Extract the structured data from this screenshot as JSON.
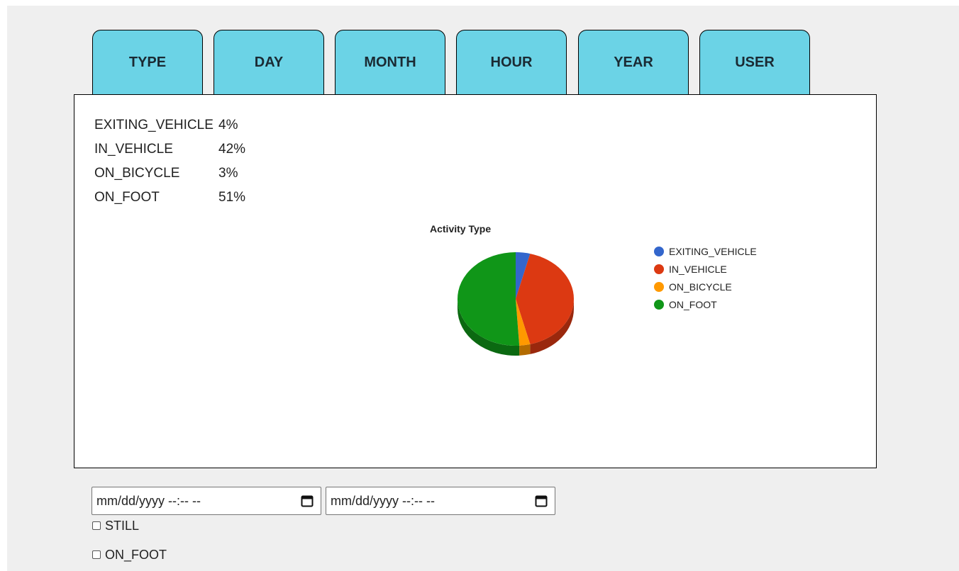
{
  "tabs": [
    {
      "label": "TYPE"
    },
    {
      "label": "DAY"
    },
    {
      "label": "MONTH"
    },
    {
      "label": "HOUR"
    },
    {
      "label": "YEAR"
    },
    {
      "label": "USER"
    }
  ],
  "stats": [
    {
      "name": "EXITING_VEHICLE",
      "value": "4%"
    },
    {
      "name": "IN_VEHICLE",
      "value": "42%"
    },
    {
      "name": "ON_BICYCLE",
      "value": "3%"
    },
    {
      "name": "ON_FOOT",
      "value": "51%"
    }
  ],
  "chart_data": {
    "type": "pie",
    "title": "Activity Type",
    "legend_position": "right",
    "slices": [
      {
        "label": "EXITING_VEHICLE",
        "value": 4,
        "color": "#3366cc",
        "dark": "#24488f"
      },
      {
        "label": "IN_VEHICLE",
        "value": 42,
        "color": "#dc3912",
        "dark": "#9a280d"
      },
      {
        "label": "ON_BICYCLE",
        "value": 3,
        "color": "#ff9900",
        "dark": "#b36b00"
      },
      {
        "label": "ON_FOOT",
        "value": 51,
        "color": "#109618",
        "dark": "#0b6911"
      }
    ]
  },
  "filters": {
    "start_placeholder": "mm/dd/yyyy --:-- --",
    "end_placeholder": "mm/dd/yyyy --:-- --",
    "checkboxes": [
      {
        "label": "STILL",
        "checked": false
      },
      {
        "label": "ON_FOOT",
        "checked": false
      }
    ]
  },
  "colors": {
    "tab_bg": "#6bd3e6",
    "page_bg": "#efefef"
  }
}
